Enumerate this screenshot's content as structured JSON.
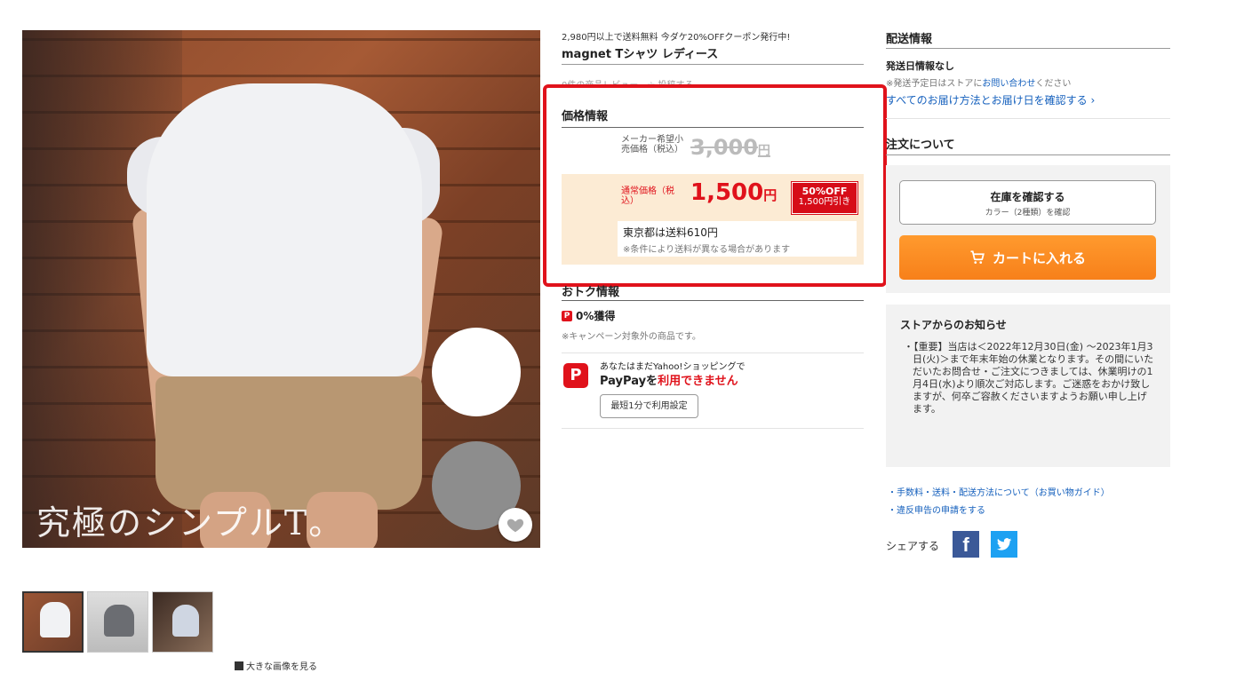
{
  "product_image": {
    "caption": "究極のシンプルT。"
  },
  "gallery": {
    "view_large": "大きな画像を見る"
  },
  "header": {
    "promo": "2,980円以上で送料無料 今ダケ20%OFFクーポン発行中!",
    "title": "magnet Tシャツ レディース",
    "review_peek": "0件の商品レビュー　☆ 投稿する"
  },
  "price": {
    "heading": "価格情報",
    "msrp_label": "メーカー希望小売価格（税込）",
    "msrp_value": "3,000",
    "sale_label": "通常価格（税込）",
    "sale_value": "1,500",
    "currency": "円",
    "discount_pct": "50%OFF",
    "discount_amount": "1,500円引き",
    "shipping": "東京都は送料610円",
    "shipping_note": "※条件により送料が異なる場合があります"
  },
  "deals": {
    "heading": "おトク情報",
    "points": "0%獲得",
    "points_icon_text": "P",
    "campaign_note": "※キャンペーン対象外の商品です。",
    "paypay_line1": "あなたはまだYahoo!ショッピングで",
    "paypay_line2_prefix": "PayPayを",
    "paypay_line2_emph": "利用できません",
    "setup_button": "最短1分で利用設定"
  },
  "delivery": {
    "heading": "配送情報",
    "ship_date": "発送日情報なし",
    "ship_note_prefix": "※発送予定日はストアに",
    "ship_note_link": "お問い合わせ",
    "ship_note_suffix": "ください",
    "all_delivery_link": "すべてのお届け方法とお届け日を確認する ›"
  },
  "order": {
    "heading": "注文について",
    "stock_button": "在庫を確認する",
    "stock_sub": "カラー（2種類）を確認",
    "cart_button": "カートに入れる"
  },
  "notice": {
    "title": "ストアからのお知らせ",
    "body": "・【重要】当店は＜2022年12月30日(金) ～2023年1月3日(火)＞まで年末年始の休業となります。その間にいただいたお問合せ・ご注文につきましては、休業明けの1月4日(水)より順次ご対応します。ご迷惑をおかけ致しますが、何卒ご容赦くださいますようお願い申し上げます。"
  },
  "links": {
    "guide": "・手数料・送料・配送方法について（お買い物ガイド）",
    "report": "・違反申告の申請をする"
  },
  "share": {
    "label": "シェアする",
    "facebook_text": "f"
  },
  "colors": {
    "accent_red": "#e0121b",
    "cart_orange": "#f7801a",
    "link_blue": "#1560bd"
  }
}
